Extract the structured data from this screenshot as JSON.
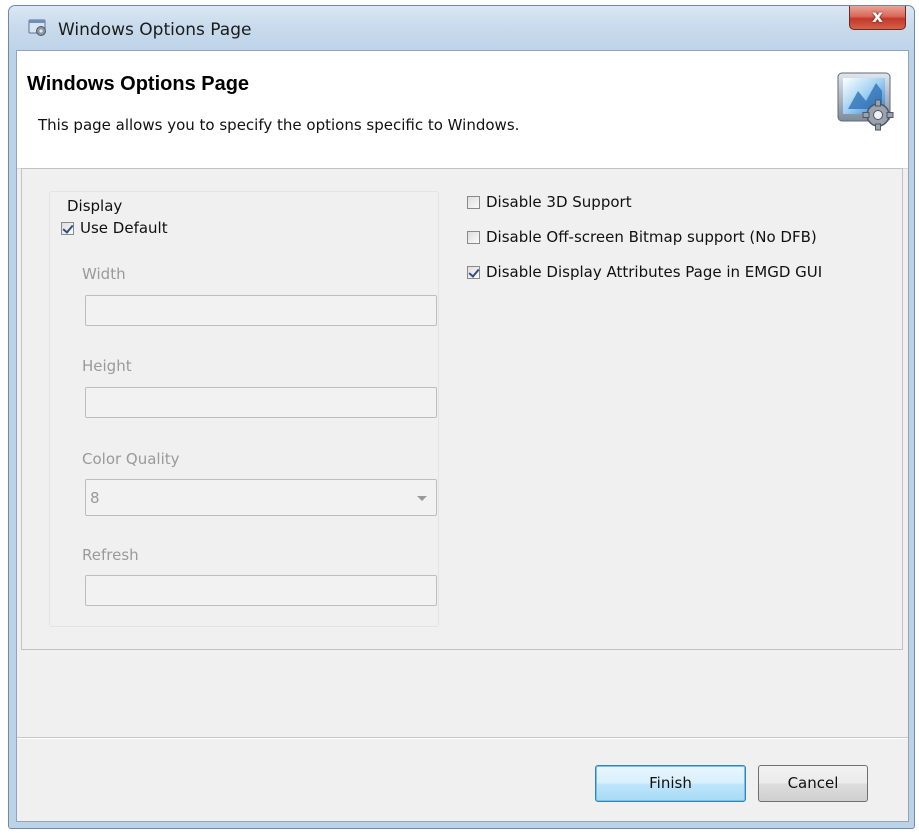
{
  "window": {
    "title": "Windows Options Page",
    "close_label": "x"
  },
  "header": {
    "title": "Windows Options Page",
    "description": "This page allows you to specify the options specific to Windows."
  },
  "display_group": {
    "legend": "Display",
    "use_default": {
      "label": "Use Default",
      "checked": true
    },
    "fields": {
      "width": {
        "label": "Width",
        "value": ""
      },
      "height": {
        "label": "Height",
        "value": ""
      },
      "color_quality": {
        "label": "Color Quality",
        "value": "8"
      },
      "refresh": {
        "label": "Refresh",
        "value": ""
      }
    }
  },
  "options": [
    {
      "label": "Disable 3D Support",
      "checked": false
    },
    {
      "label": "Disable Off-screen Bitmap support (No DFB)",
      "checked": false
    },
    {
      "label": "Disable Display Attributes Page in EMGD GUI",
      "checked": true
    }
  ],
  "buttons": {
    "finish": "Finish",
    "cancel": "Cancel"
  },
  "colors": {
    "title_bar": "#bcd2e7",
    "close_button": "#c4382a",
    "default_button_border": "#3c7fb1",
    "disabled_text": "#9a9a9a"
  }
}
